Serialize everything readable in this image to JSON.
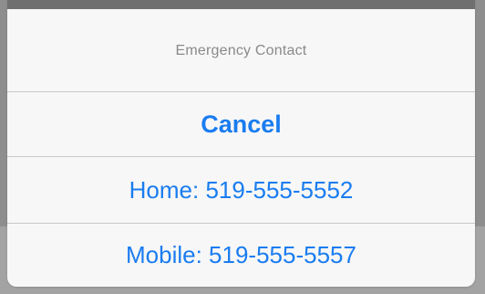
{
  "action_sheet": {
    "title": "Emergency Contact",
    "cancel_label": "Cancel",
    "options": [
      {
        "label": "Home: 519-555-5552"
      },
      {
        "label": "Mobile: 519-555-5557"
      }
    ]
  },
  "colors": {
    "accent": "#1a7cf0",
    "title_text": "#8a8a8a",
    "sheet_background": "#f7f7f7",
    "divider": "#c8c8cc",
    "dimmed_backdrop": "#8e8e8e"
  }
}
